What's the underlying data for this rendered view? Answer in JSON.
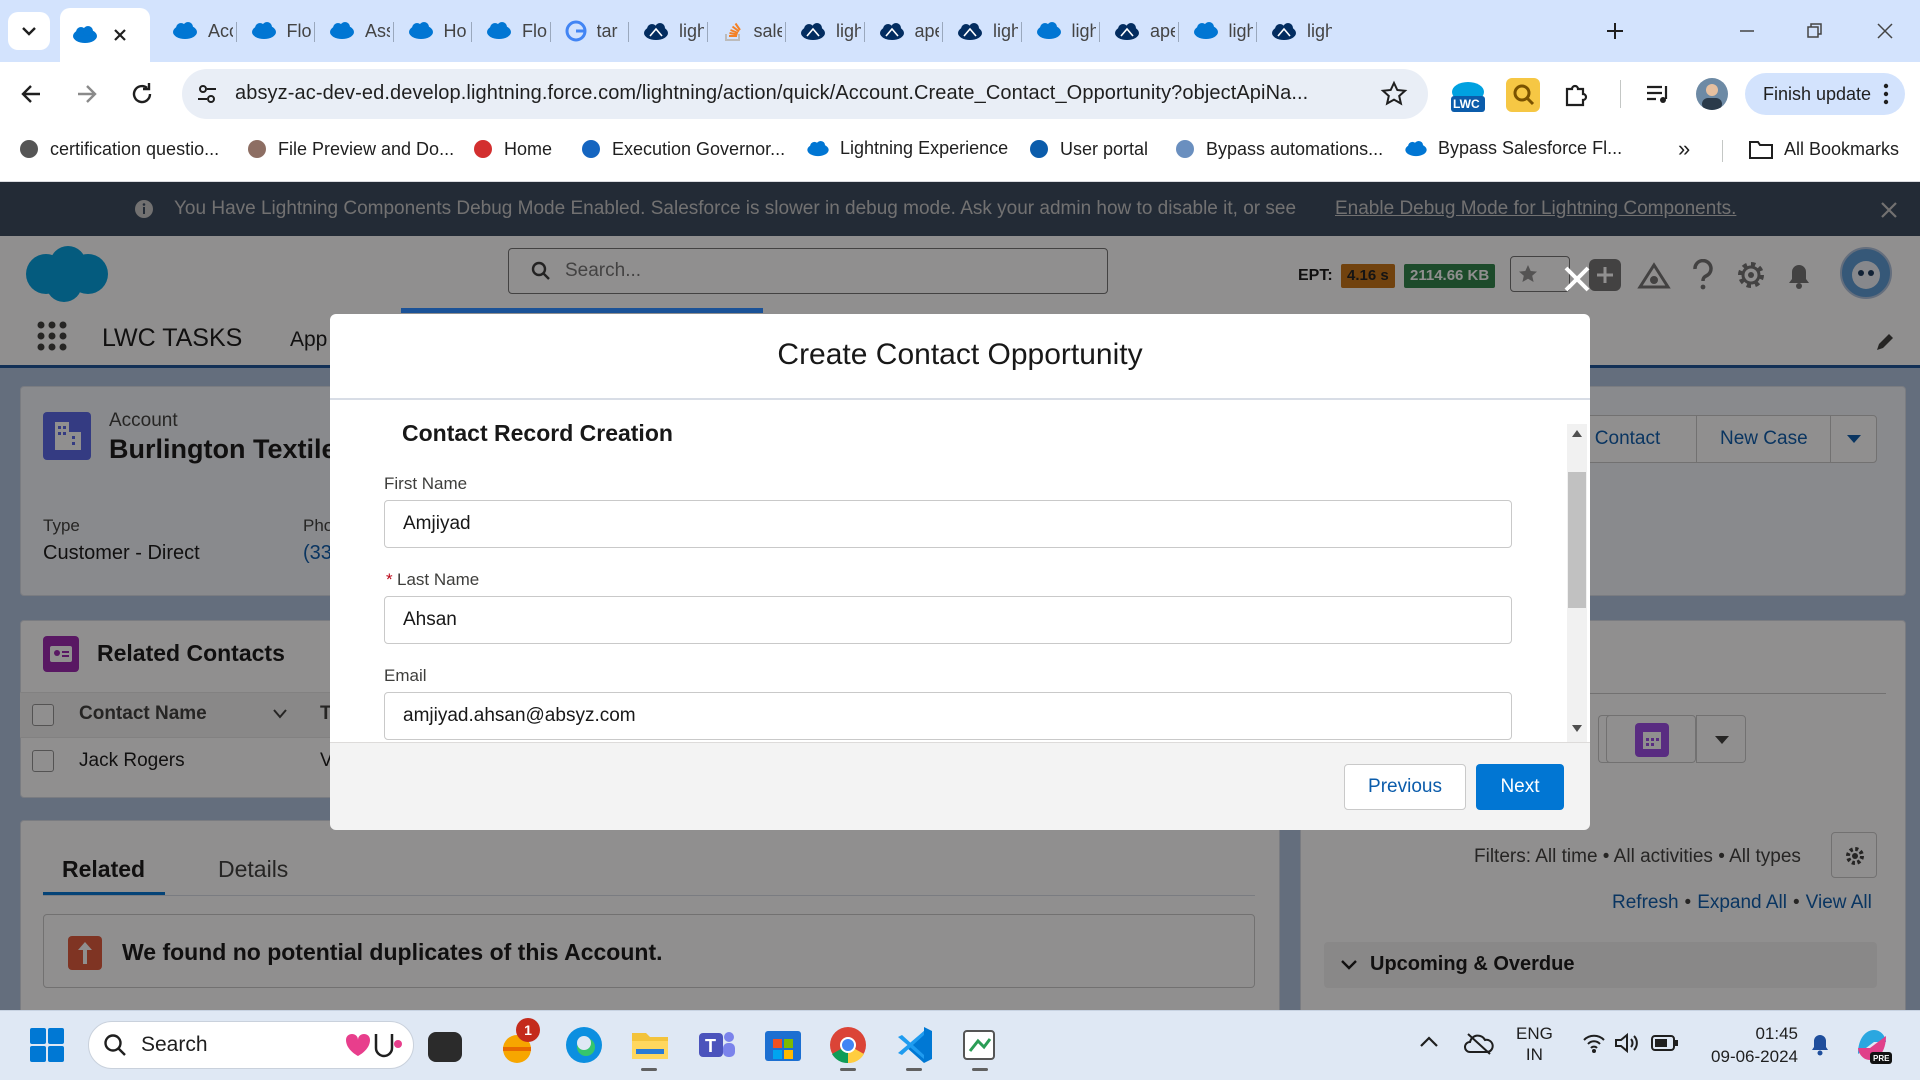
{
  "browser": {
    "tabs": [
      {
        "label": "Acc",
        "icon": "salesforce-cloud-icon"
      },
      {
        "label": "Flo",
        "icon": "salesforce-cloud-icon"
      },
      {
        "label": "Ass",
        "icon": "salesforce-cloud-icon"
      },
      {
        "label": "Ho",
        "icon": "salesforce-cloud-icon"
      },
      {
        "label": "Flo",
        "icon": "salesforce-cloud-icon"
      },
      {
        "label": "tar",
        "icon": "google-icon"
      },
      {
        "label": "ligh",
        "icon": "trailhead-icon"
      },
      {
        "label": "sale",
        "icon": "stackoverflow-icon"
      },
      {
        "label": "ligh",
        "icon": "trailhead-icon"
      },
      {
        "label": "ape",
        "icon": "trailhead-icon"
      },
      {
        "label": "ligh",
        "icon": "trailhead-icon"
      },
      {
        "label": "ligh",
        "icon": "salesforce-cloud-icon"
      },
      {
        "label": "ape",
        "icon": "trailhead-icon"
      },
      {
        "label": "ligh",
        "icon": "salesforce-cloud-icon"
      },
      {
        "label": "ligh",
        "icon": "trailhead-icon"
      }
    ],
    "url": "absyz-ac-dev-ed.develop.lightning.force.com/lightning/action/quick/Account.Create_Contact_Opportunity?objectApiNa...",
    "extension_badge": "LWC",
    "finish_update_label": "Finish update",
    "bookmarks": [
      {
        "label": "certification questio...",
        "icon": "bookmark-favicon"
      },
      {
        "label": "File Preview and Do...",
        "icon": "bookmark-favicon"
      },
      {
        "label": "Home",
        "icon": "bookmark-favicon"
      },
      {
        "label": "Execution Governor...",
        "icon": "bookmark-favicon"
      },
      {
        "label": "Lightning Experience",
        "icon": "salesforce-cloud-icon"
      },
      {
        "label": "User portal",
        "icon": "bookmark-favicon"
      },
      {
        "label": "Bypass automations...",
        "icon": "bookmark-favicon"
      },
      {
        "label": "Bypass Salesforce Fl...",
        "icon": "salesforce-cloud-icon"
      }
    ],
    "more_bookmarks": "»",
    "all_bookmarks_label": "All Bookmarks"
  },
  "debug_banner": {
    "text": "You Have Lightning Components Debug Mode Enabled. Salesforce is slower in debug mode. Ask your admin how to disable it, or see",
    "link": "Enable Debug Mode for Lightning Components."
  },
  "sf_header": {
    "search_placeholder": "Search...",
    "ept_label": "EPT:",
    "ept_time": "4.16 s",
    "ept_size": "2114.66 KB"
  },
  "sf_nav": {
    "app_name": "LWC TASKS",
    "first_item": "App"
  },
  "record": {
    "object_label": "Account",
    "name": "Burlington Textile",
    "type_label": "Type",
    "type_value": "Customer - Direct",
    "phone_label": "Pho",
    "phone_value": "(33",
    "actions": [
      "v Contact",
      "New Case"
    ]
  },
  "related_contacts": {
    "title": "Related Contacts",
    "column_contact_name": "Contact Name",
    "column_second": "T",
    "rows": [
      {
        "name": "Jack Rogers",
        "second": "V"
      }
    ]
  },
  "tabs": {
    "related": "Related",
    "details": "Details"
  },
  "duplicates_message": "We found no potential duplicates of this Account.",
  "activity": {
    "filters": "Filters: All time • All activities • All types",
    "refresh": "Refresh",
    "expand_all": "Expand All",
    "view_all": "View All",
    "dot": "•",
    "upcoming": "Upcoming & Overdue"
  },
  "modal": {
    "title": "Create Contact Opportunity",
    "section_title": "Contact Record Creation",
    "fields": {
      "first_name_label": "First Name",
      "first_name_value": "Amjiyad",
      "last_name_label": "Last Name",
      "last_name_value": "Ahsan",
      "required_marker": "*",
      "email_label": "Email",
      "email_value": "amjiyad.ahsan@absyz.com"
    },
    "previous_label": "Previous",
    "next_label": "Next"
  },
  "taskbar": {
    "search_label": "Search",
    "notification_count": "1",
    "language": "ENG",
    "region": "IN",
    "time": "01:45",
    "date": "09-06-2024"
  },
  "colors": {
    "brand_blue": "#0176d3",
    "salesforce_cloud": "#00a1e0",
    "ept_time_bg": "#c77415",
    "ept_size_bg": "#2e844a",
    "account_icon": "#5867e8",
    "contacts_icon": "#9c27b0"
  }
}
